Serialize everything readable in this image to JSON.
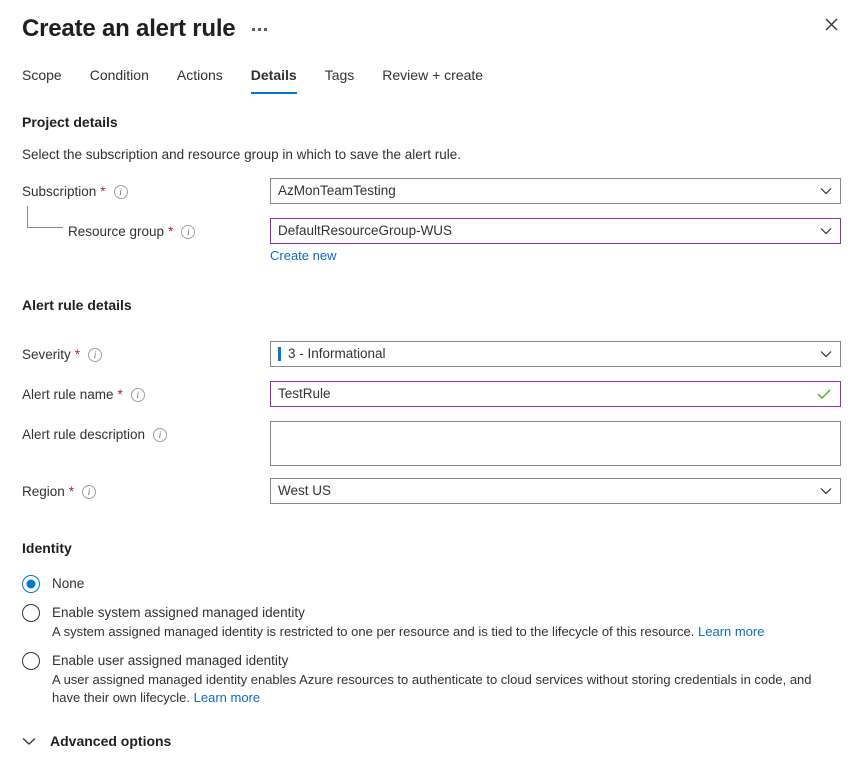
{
  "header": {
    "title": "Create an alert rule",
    "more_menu": "…",
    "close_label": "Close"
  },
  "tabs": [
    {
      "label": "Scope",
      "active": false
    },
    {
      "label": "Condition",
      "active": false
    },
    {
      "label": "Actions",
      "active": false
    },
    {
      "label": "Details",
      "active": true
    },
    {
      "label": "Tags",
      "active": false
    },
    {
      "label": "Review + create",
      "active": false
    }
  ],
  "project_details": {
    "section_title": "Project details",
    "description": "Select the subscription and resource group in which to save the alert rule.",
    "subscription": {
      "label": "Subscription",
      "required": "*",
      "value": "AzMonTeamTesting"
    },
    "resource_group": {
      "label": "Resource group",
      "required": "*",
      "value": "DefaultResourceGroup-WUS",
      "create_new_label": "Create new"
    }
  },
  "alert_rule_details": {
    "section_title": "Alert rule details",
    "severity": {
      "label": "Severity",
      "required": "*",
      "value": "3 - Informational",
      "indicator_color": "#0078d4"
    },
    "alert_rule_name": {
      "label": "Alert rule name",
      "required": "*",
      "value": "TestRule",
      "valid": true
    },
    "alert_rule_description": {
      "label": "Alert rule description",
      "value": "",
      "placeholder": ""
    },
    "region": {
      "label": "Region",
      "required": "*",
      "value": "West US"
    }
  },
  "identity": {
    "section_title": "Identity",
    "options": [
      {
        "label": "None",
        "selected": true,
        "description": "",
        "link_text": ""
      },
      {
        "label": "Enable system assigned managed identity",
        "selected": false,
        "description": "A system assigned managed identity is restricted to one per resource and is tied to the lifecycle of this resource. ",
        "link_text": "Learn more"
      },
      {
        "label": "Enable user assigned managed identity",
        "selected": false,
        "description": "A user assigned managed identity enables Azure resources to authenticate to cloud services without storing credentials in code, and have their own lifecycle. ",
        "link_text": "Learn more"
      }
    ]
  },
  "advanced_options": {
    "label": "Advanced options",
    "expanded": false
  },
  "colors": {
    "accent": "#0078d4",
    "link": "#0f6cbd",
    "required_asterisk": "#a4262c",
    "touched_border": "#8f2fb0",
    "valid_check": "#4caf2f",
    "border": "#8a8886"
  }
}
